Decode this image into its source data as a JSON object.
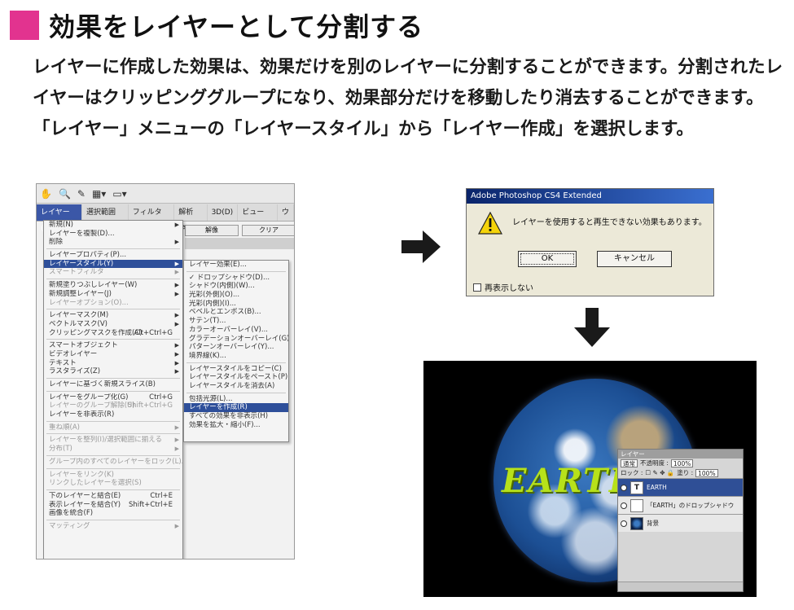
{
  "heading": {
    "title": "効果をレイヤーとして分割する",
    "accent_color": "#e2338f"
  },
  "body": {
    "paragraph": "レイヤーに作成した効果は、効果だけを別のレイヤーに分割することができます。分割されたレイヤーはクリッピンググループになり、効果部分だけを移動したり消去することができます。「レイヤー」メニューの「レイヤースタイル」から「レイヤー作成」を選択します。"
  },
  "screenshot_menu": {
    "menubar": [
      "レイヤー(L)",
      "選択範囲(S)",
      "フィルタ(T)",
      "解析(A)",
      "3D(D)",
      "ビュー(V)",
      "ウ"
    ],
    "bg_buttons": [
      "解像",
      "クリア"
    ],
    "main_items": [
      {
        "label": "新規(N)",
        "arrow": true
      },
      {
        "label": "レイヤーを複製(D)...",
        "arrow": false
      },
      {
        "label": "削除",
        "arrow": true
      },
      {
        "sep": true
      },
      {
        "label": "レイヤープロパティ(P)...",
        "arrow": false
      },
      {
        "label": "レイヤースタイル(Y)",
        "arrow": true,
        "highlight": true
      },
      {
        "label": "スマートフィルタ",
        "arrow": true,
        "dim": true
      },
      {
        "sep": true
      },
      {
        "label": "新規塗りつぶしレイヤー(W)",
        "arrow": true
      },
      {
        "label": "新規調整レイヤー(J)",
        "arrow": true
      },
      {
        "label": "レイヤーオプション(O)...",
        "arrow": false,
        "dim": true
      },
      {
        "sep": true
      },
      {
        "label": "レイヤーマスク(M)",
        "arrow": true
      },
      {
        "label": "ベクトルマスク(V)",
        "arrow": true
      },
      {
        "label": "クリッピングマスクを作成(C)",
        "shortcut": "Alt+Ctrl+G"
      },
      {
        "sep": true
      },
      {
        "label": "スマートオブジェクト",
        "arrow": true
      },
      {
        "label": "ビデオレイヤー",
        "arrow": true
      },
      {
        "label": "テキスト",
        "arrow": true
      },
      {
        "label": "ラスタライズ(Z)",
        "arrow": true
      },
      {
        "sep": true
      },
      {
        "label": "レイヤーに基づく新規スライス(B)",
        "arrow": false
      },
      {
        "sep": true
      },
      {
        "label": "レイヤーをグループ化(G)",
        "shortcut": "Ctrl+G"
      },
      {
        "label": "レイヤーのグループ解除(U)",
        "shortcut": "Shift+Ctrl+G",
        "dim": true
      },
      {
        "label": "レイヤーを非表示(R)",
        "arrow": false
      },
      {
        "sep": true
      },
      {
        "label": "重ね順(A)",
        "arrow": true,
        "dim": true
      },
      {
        "sep": true
      },
      {
        "label": "レイヤーを整列(I)/選択範囲に揃える",
        "arrow": true,
        "dim": true
      },
      {
        "label": "分布(T)",
        "arrow": true,
        "dim": true
      },
      {
        "sep": true
      },
      {
        "label": "グループ内のすべてのレイヤーをロック(L)...",
        "arrow": false,
        "dim": true
      },
      {
        "sep": true
      },
      {
        "label": "レイヤーをリンク(K)",
        "arrow": false,
        "dim": true
      },
      {
        "label": "リンクしたレイヤーを選択(S)",
        "arrow": false,
        "dim": true
      },
      {
        "sep": true
      },
      {
        "label": "下のレイヤーと結合(E)",
        "shortcut": "Ctrl+E"
      },
      {
        "label": "表示レイヤーを結合(Y)",
        "shortcut": "Shift+Ctrl+E"
      },
      {
        "label": "画像を統合(F)",
        "arrow": false
      },
      {
        "sep": true
      },
      {
        "label": "マッティング",
        "arrow": true,
        "dim": true
      }
    ],
    "sub_items": [
      {
        "label": "レイヤー効果(E)...",
        "arrow": false
      },
      {
        "sep": true
      },
      {
        "label": "ドロップシャドウ(D)...",
        "check": true
      },
      {
        "label": "シャドウ(内側)(W)...",
        "arrow": false
      },
      {
        "label": "光彩(外側)(O)...",
        "arrow": false
      },
      {
        "label": "光彩(内側)(I)...",
        "arrow": false
      },
      {
        "label": "ベベルとエンボス(B)...",
        "arrow": false
      },
      {
        "label": "サテン(T)...",
        "arrow": false
      },
      {
        "label": "カラーオーバーレイ(V)...",
        "arrow": false
      },
      {
        "label": "グラデーションオーバーレイ(G)...",
        "arrow": false
      },
      {
        "label": "パターンオーバーレイ(Y)...",
        "arrow": false
      },
      {
        "label": "境界線(K)...",
        "arrow": false
      },
      {
        "sep": true
      },
      {
        "label": "レイヤースタイルをコピー(C)",
        "arrow": false
      },
      {
        "label": "レイヤースタイルをペースト(P)",
        "arrow": false
      },
      {
        "label": "レイヤースタイルを消去(A)",
        "arrow": false
      },
      {
        "sep": true
      },
      {
        "label": "包括光源(L)...",
        "arrow": false
      },
      {
        "label": "レイヤーを作成(R)",
        "highlight": true
      },
      {
        "label": "すべての効果を非表示(H)",
        "arrow": false
      },
      {
        "label": "効果を拡大・縮小(F)...",
        "arrow": false
      }
    ]
  },
  "dialog": {
    "title": "Adobe Photoshop CS4 Extended",
    "message": "レイヤーを使用すると再生できない効果もあります。",
    "ok_label": "OK",
    "cancel_label": "キャンセル",
    "checkbox_label": "再表示しない"
  },
  "earth_image": {
    "label": "EARTH",
    "label_color": "#b7e21a",
    "layers_panel": {
      "title": "レイヤー",
      "blend_mode": "通常",
      "opacity_label": "不透明度 :",
      "opacity_value": "100%",
      "lock_label": "ロック :",
      "fill_label": "塗り :",
      "fill_value": "100%",
      "layers": [
        {
          "name": "EARTH",
          "thumb": "T",
          "selected": true
        },
        {
          "name": "「EARTH」のドロップシャドウ",
          "thumb": "",
          "selected": false
        },
        {
          "name": "背景",
          "thumb": "earth",
          "selected": false
        }
      ]
    }
  }
}
